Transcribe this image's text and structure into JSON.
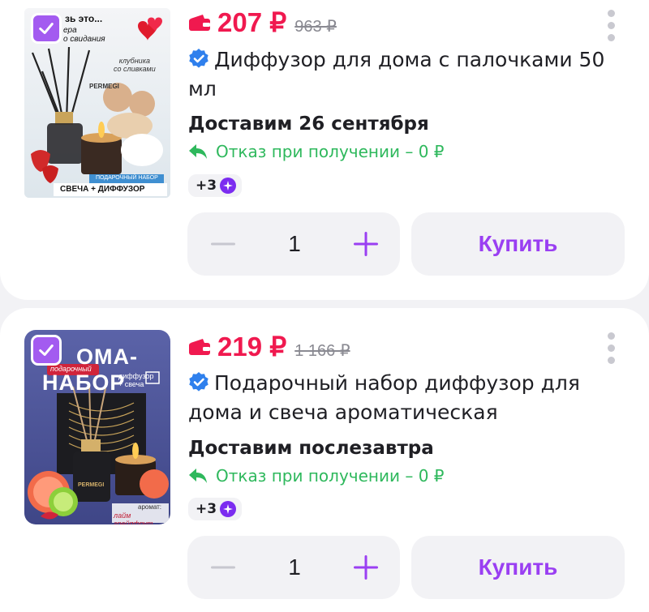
{
  "items": [
    {
      "price": "207 ₽",
      "old_price": "963 ₽",
      "title": "Диффузор для дома с палочками 50 мл",
      "delivery": "Доставим 26 сентября",
      "return_text": "Отказ при получении – 0 ₽",
      "extra_count": "+3",
      "quantity": "1",
      "buy_label": "Купить",
      "image": {
        "top_text": "зь это...",
        "sub_text": "ера\nо свидания",
        "flavor_text": "клубника\nсо сливками",
        "brand": "PERMEGI",
        "set_label": "ПОДАРОЧНЫЙ НАБОР",
        "caption": "СВЕЧА + ДИФФУЗОР"
      }
    },
    {
      "price": "219 ₽",
      "old_price": "1 166 ₽",
      "title": "Подарочный набор диффузор для дома и свеча ароматическая",
      "delivery": "Доставим послезавтра",
      "return_text": "Отказ при получении – 0 ₽",
      "extra_count": "+3",
      "quantity": "1",
      "buy_label": "Купить",
      "image": {
        "heading_1": "ОМА-",
        "heading_2": "НАБОР",
        "ribbon": "подарочный",
        "side_text": "диффузор\n+ свеча",
        "brand": "PERMEGI",
        "aroma_label": "аромат:",
        "aroma_name": "лайм грейпфрут"
      }
    }
  ],
  "colors": {
    "price": "#f0194f",
    "accent": "#9a3ff2",
    "checkbox": "#a35bf0",
    "return": "#2eb85c",
    "verified": "#2f80ed"
  }
}
